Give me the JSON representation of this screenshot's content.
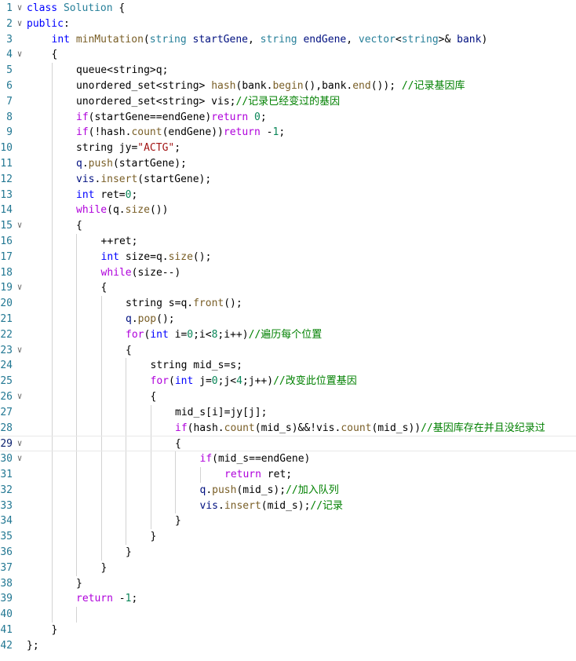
{
  "editor": {
    "current_line": 29,
    "lines": [
      {
        "n": "1",
        "fold": true,
        "indent": 0,
        "tokens": [
          [
            "kw",
            "class "
          ],
          [
            "ty",
            "Solution"
          ],
          [
            "pu",
            " {"
          ]
        ]
      },
      {
        "n": "2",
        "fold": true,
        "indent": 0,
        "tokens": [
          [
            "kw",
            "public"
          ],
          [
            "pu",
            ":"
          ]
        ]
      },
      {
        "n": "3",
        "fold": false,
        "indent": 1,
        "tokens": [
          [
            "kw",
            "int "
          ],
          [
            "fn",
            "minMutation"
          ],
          [
            "pu",
            "("
          ],
          [
            "ty",
            "string "
          ],
          [
            "va",
            "startGene"
          ],
          [
            "pu",
            ", "
          ],
          [
            "ty",
            "string "
          ],
          [
            "va",
            "endGene"
          ],
          [
            "pu",
            ", "
          ],
          [
            "ty",
            "vector"
          ],
          [
            "pu",
            "<"
          ],
          [
            "ty",
            "string"
          ],
          [
            "pu",
            ">& "
          ],
          [
            "va",
            "bank"
          ],
          [
            "pu",
            ")"
          ]
        ]
      },
      {
        "n": "4",
        "fold": true,
        "indent": 1,
        "tokens": [
          [
            "pu",
            "{"
          ]
        ]
      },
      {
        "n": "5",
        "fold": false,
        "indent": 2,
        "tokens": [
          [
            "pu",
            "queue<string>q;"
          ]
        ]
      },
      {
        "n": "6",
        "fold": false,
        "indent": 2,
        "tokens": [
          [
            "pu",
            "unordered_set<string> "
          ],
          [
            "fn",
            "hash"
          ],
          [
            "pu",
            "(bank."
          ],
          [
            "fn",
            "begin"
          ],
          [
            "pu",
            "(),bank."
          ],
          [
            "fn",
            "end"
          ],
          [
            "pu",
            "()); "
          ],
          [
            "cm",
            "//记录基因库"
          ]
        ]
      },
      {
        "n": "7",
        "fold": false,
        "indent": 2,
        "tokens": [
          [
            "pu",
            "unordered_set<string> vis;"
          ],
          [
            "cm",
            "//记录已经变过的基因"
          ]
        ]
      },
      {
        "n": "8",
        "fold": false,
        "indent": 2,
        "tokens": [
          [
            "cf",
            "if"
          ],
          [
            "pu",
            "(startGene==endGene)"
          ],
          [
            "cf",
            "return "
          ],
          [
            "num",
            "0"
          ],
          [
            "pu",
            ";"
          ]
        ]
      },
      {
        "n": "9",
        "fold": false,
        "indent": 2,
        "tokens": [
          [
            "cf",
            "if"
          ],
          [
            "pu",
            "(!hash."
          ],
          [
            "fn",
            "count"
          ],
          [
            "pu",
            "(endGene))"
          ],
          [
            "cf",
            "return "
          ],
          [
            "pu",
            "-"
          ],
          [
            "num",
            "1"
          ],
          [
            "pu",
            ";"
          ]
        ]
      },
      {
        "n": "10",
        "fold": false,
        "indent": 2,
        "tokens": [
          [
            "pu",
            "string jy="
          ],
          [
            "str",
            "\"ACTG\""
          ],
          [
            "pu",
            ";"
          ]
        ]
      },
      {
        "n": "11",
        "fold": false,
        "indent": 2,
        "tokens": [
          [
            "va",
            "q"
          ],
          [
            "pu",
            "."
          ],
          [
            "fn",
            "push"
          ],
          [
            "pu",
            "(startGene);"
          ]
        ]
      },
      {
        "n": "12",
        "fold": false,
        "indent": 2,
        "tokens": [
          [
            "va",
            "vis"
          ],
          [
            "pu",
            "."
          ],
          [
            "fn",
            "insert"
          ],
          [
            "pu",
            "(startGene);"
          ]
        ]
      },
      {
        "n": "13",
        "fold": false,
        "indent": 2,
        "tokens": [
          [
            "kw",
            "int "
          ],
          [
            "pu",
            "ret="
          ],
          [
            "num",
            "0"
          ],
          [
            "pu",
            ";"
          ]
        ]
      },
      {
        "n": "14",
        "fold": false,
        "indent": 2,
        "tokens": [
          [
            "cf",
            "while"
          ],
          [
            "pu",
            "(q."
          ],
          [
            "fn",
            "size"
          ],
          [
            "pu",
            "())"
          ]
        ]
      },
      {
        "n": "15",
        "fold": true,
        "indent": 2,
        "tokens": [
          [
            "pu",
            "{"
          ]
        ]
      },
      {
        "n": "16",
        "fold": false,
        "indent": 3,
        "tokens": [
          [
            "pu",
            "++ret;"
          ]
        ]
      },
      {
        "n": "17",
        "fold": false,
        "indent": 3,
        "tokens": [
          [
            "kw",
            "int "
          ],
          [
            "pu",
            "size=q."
          ],
          [
            "fn",
            "size"
          ],
          [
            "pu",
            "();"
          ]
        ]
      },
      {
        "n": "18",
        "fold": false,
        "indent": 3,
        "tokens": [
          [
            "cf",
            "while"
          ],
          [
            "pu",
            "(size--)"
          ]
        ]
      },
      {
        "n": "19",
        "fold": true,
        "indent": 3,
        "tokens": [
          [
            "pu",
            "{"
          ]
        ]
      },
      {
        "n": "20",
        "fold": false,
        "indent": 4,
        "tokens": [
          [
            "pu",
            "string s=q."
          ],
          [
            "fn",
            "front"
          ],
          [
            "pu",
            "();"
          ]
        ]
      },
      {
        "n": "21",
        "fold": false,
        "indent": 4,
        "tokens": [
          [
            "va",
            "q"
          ],
          [
            "pu",
            "."
          ],
          [
            "fn",
            "pop"
          ],
          [
            "pu",
            "();"
          ]
        ]
      },
      {
        "n": "22",
        "fold": false,
        "indent": 4,
        "tokens": [
          [
            "cf",
            "for"
          ],
          [
            "pu",
            "("
          ],
          [
            "kw",
            "int "
          ],
          [
            "pu",
            "i="
          ],
          [
            "num",
            "0"
          ],
          [
            "pu",
            ";i<"
          ],
          [
            "num",
            "8"
          ],
          [
            "pu",
            ";i++)"
          ],
          [
            "cm",
            "//遍历每个位置"
          ]
        ]
      },
      {
        "n": "23",
        "fold": true,
        "indent": 4,
        "tokens": [
          [
            "pu",
            "{"
          ]
        ]
      },
      {
        "n": "24",
        "fold": false,
        "indent": 5,
        "tokens": [
          [
            "pu",
            "string mid_s=s;"
          ]
        ]
      },
      {
        "n": "25",
        "fold": false,
        "indent": 5,
        "tokens": [
          [
            "cf",
            "for"
          ],
          [
            "pu",
            "("
          ],
          [
            "kw",
            "int "
          ],
          [
            "pu",
            "j="
          ],
          [
            "num",
            "0"
          ],
          [
            "pu",
            ";j<"
          ],
          [
            "num",
            "4"
          ],
          [
            "pu",
            ";j++)"
          ],
          [
            "cm",
            "//改变此位置基因"
          ]
        ]
      },
      {
        "n": "26",
        "fold": true,
        "indent": 5,
        "tokens": [
          [
            "pu",
            "{"
          ]
        ]
      },
      {
        "n": "27",
        "fold": false,
        "indent": 6,
        "tokens": [
          [
            "pu",
            "mid_s[i]=jy[j];"
          ]
        ]
      },
      {
        "n": "28",
        "fold": false,
        "indent": 6,
        "tokens": [
          [
            "cf",
            "if"
          ],
          [
            "pu",
            "(hash."
          ],
          [
            "fn",
            "count"
          ],
          [
            "pu",
            "(mid_s)&&!vis."
          ],
          [
            "fn",
            "count"
          ],
          [
            "pu",
            "(mid_s))"
          ],
          [
            "cm",
            "//基因库存在并且没纪录过"
          ]
        ]
      },
      {
        "n": "29",
        "fold": true,
        "indent": 6,
        "tokens": [
          [
            "pu",
            "{"
          ]
        ]
      },
      {
        "n": "30",
        "fold": true,
        "indent": 7,
        "tokens": [
          [
            "cf",
            "if"
          ],
          [
            "pu",
            "(mid_s==endGene)"
          ]
        ]
      },
      {
        "n": "31",
        "fold": false,
        "indent": 8,
        "tokens": [
          [
            "cf",
            "return "
          ],
          [
            "pu",
            "ret;"
          ]
        ]
      },
      {
        "n": "32",
        "fold": false,
        "indent": 7,
        "tokens": [
          [
            "va",
            "q"
          ],
          [
            "pu",
            "."
          ],
          [
            "fn",
            "push"
          ],
          [
            "pu",
            "(mid_s);"
          ],
          [
            "cm",
            "//加入队列"
          ]
        ]
      },
      {
        "n": "33",
        "fold": false,
        "indent": 7,
        "tokens": [
          [
            "va",
            "vis"
          ],
          [
            "pu",
            "."
          ],
          [
            "fn",
            "insert"
          ],
          [
            "pu",
            "(mid_s);"
          ],
          [
            "cm",
            "//记录"
          ]
        ]
      },
      {
        "n": "34",
        "fold": false,
        "indent": 6,
        "tokens": [
          [
            "pu",
            "}"
          ]
        ]
      },
      {
        "n": "35",
        "fold": false,
        "indent": 5,
        "tokens": [
          [
            "pu",
            "}"
          ]
        ]
      },
      {
        "n": "36",
        "fold": false,
        "indent": 4,
        "tokens": [
          [
            "pu",
            "}"
          ]
        ]
      },
      {
        "n": "37",
        "fold": false,
        "indent": 3,
        "tokens": [
          [
            "pu",
            "}"
          ]
        ]
      },
      {
        "n": "38",
        "fold": false,
        "indent": 2,
        "tokens": [
          [
            "pu",
            "}"
          ]
        ]
      },
      {
        "n": "39",
        "fold": false,
        "indent": 2,
        "tokens": [
          [
            "cf",
            "return "
          ],
          [
            "pu",
            "-"
          ],
          [
            "num",
            "1"
          ],
          [
            "pu",
            ";"
          ]
        ]
      },
      {
        "n": "40",
        "fold": false,
        "indent": 0,
        "tokens": []
      },
      {
        "n": "41",
        "fold": false,
        "indent": 1,
        "tokens": [
          [
            "pu",
            "}"
          ]
        ]
      },
      {
        "n": "42",
        "fold": false,
        "indent": 0,
        "tokens": [
          [
            "pu",
            "};"
          ]
        ]
      }
    ]
  }
}
